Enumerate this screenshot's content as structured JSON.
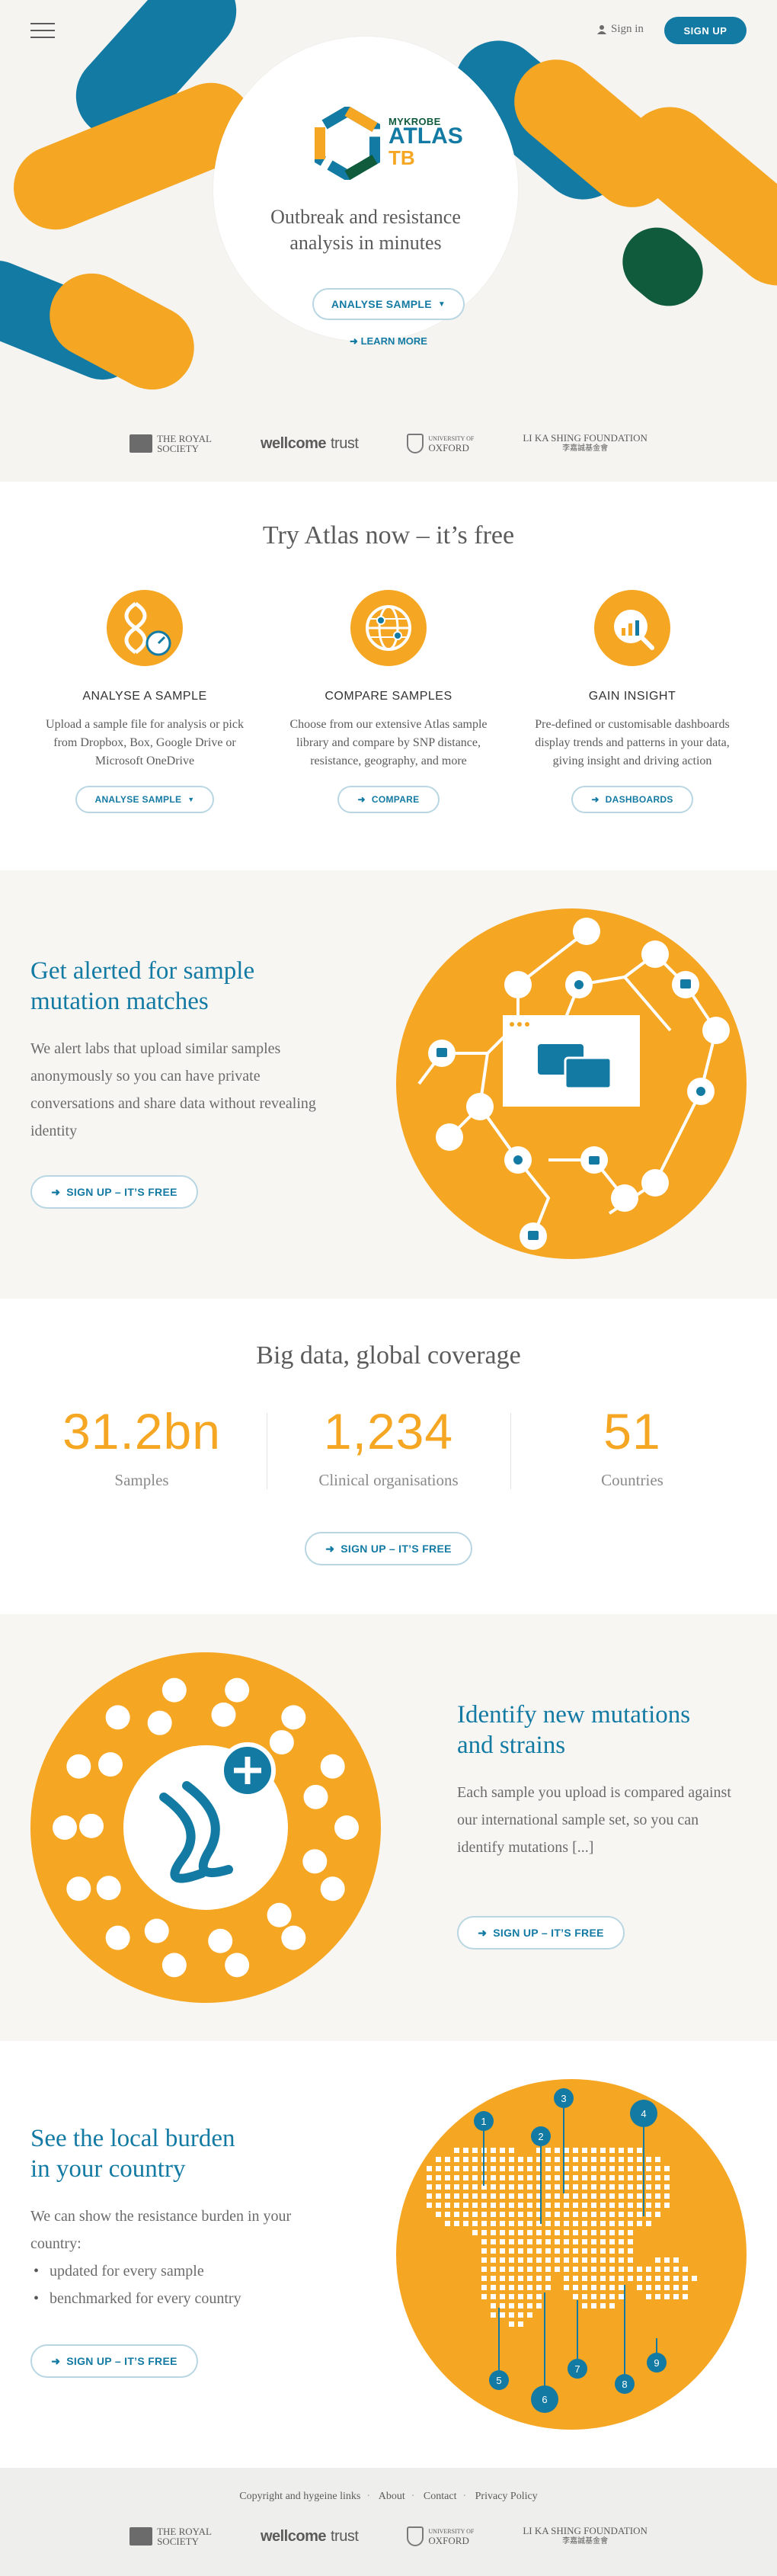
{
  "nav": {
    "signin_label": "Sign in",
    "signup_label": "SIGN UP"
  },
  "hero": {
    "logo_small": "MYKROBE",
    "logo_big": "ATLAS",
    "logo_tb": "TB",
    "tagline_line1": "Outbreak and resistance",
    "tagline_line2": "analysis in minutes",
    "analyse_button": "ANALYSE SAMPLE",
    "learn_more": "LEARN MORE"
  },
  "partners": {
    "royal_society_1": "THE ROYAL",
    "royal_society_2": "SOCIETY",
    "wellcome_bold": "wellcome",
    "wellcome_light": "trust",
    "oxford_1": "UNIVERSITY OF",
    "oxford_2": "OXFORD",
    "likashing_1": "LI KA SHING FOUNDATION",
    "likashing_2": "李嘉誠基金會"
  },
  "try_section": {
    "title": "Try Atlas now – it’s free",
    "features": [
      {
        "heading": "ANALYSE A SAMPLE",
        "text": "Upload a sample file for analysis or pick from Dropbox, Box, Google Drive or Microsoft OneDrive",
        "button": "ANALYSE SAMPLE"
      },
      {
        "heading": "COMPARE SAMPLES",
        "text": "Choose from our extensive Atlas sample library and compare by SNP distance, resistance, geography, and more",
        "button": "COMPARE"
      },
      {
        "heading": "GAIN INSIGHT",
        "text": "Pre-defined or customisable dashboards display trends and patterns in your data, giving insight and driving action",
        "button": "DASHBOARDS"
      }
    ]
  },
  "alert_section": {
    "title_line1": "Get alerted for sample",
    "title_line2": "mutation matches",
    "text": "We alert labs that upload similar samples anonymously so you can have private conversations and share data without revealing identity",
    "button": "SIGN UP – IT’S FREE"
  },
  "stats_section": {
    "title": "Big data, global coverage",
    "stats": [
      {
        "value": "31.2bn",
        "label": "Samples"
      },
      {
        "value": "1,234",
        "label": "Clinical organisations"
      },
      {
        "value": "51",
        "label": "Countries"
      }
    ],
    "button": "SIGN UP – IT’S FREE"
  },
  "mutations_section": {
    "title_line1": "Identify new mutations",
    "title_line2": "and strains",
    "text": "Each sample you upload is compared against our international sample set, so you can identify mutations [...]",
    "button": "SIGN UP – IT’S FREE"
  },
  "burden_section": {
    "title_line1": "See the local burden",
    "title_line2": "in your country",
    "text": "We can show the resistance burden in your country:",
    "bullets": [
      "updated for every sample",
      "benchmarked for every country"
    ],
    "button": "SIGN UP – IT’S FREE",
    "map_markers": [
      "1",
      "2",
      "3",
      "4",
      "5",
      "6",
      "7",
      "8",
      "9"
    ]
  },
  "footer": {
    "links": [
      "Copyright and hygeine links",
      "About",
      "Contact",
      "Privacy Policy"
    ]
  },
  "colors": {
    "orange": "#f5a623",
    "blue": "#137aa3",
    "green": "#0f5b3c"
  }
}
